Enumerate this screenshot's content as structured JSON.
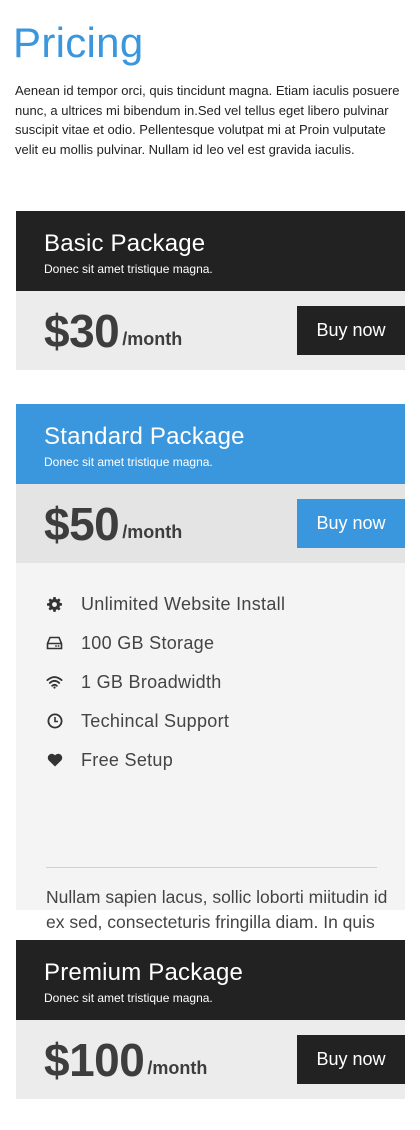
{
  "page": {
    "title": "Pricing",
    "intro": "Aenean id tempor orci, quis tincidunt magna. Etiam iaculis posuere nunc, a ultrices mi bibendum in.Sed vel tellus eget libero pulvinar suscipit vitae et odio. Pellentesque volutpat mi at Proin vulputate velit eu mollis pulvinar. Nullam id leo vel est gravida iaculis."
  },
  "plans": [
    {
      "name": "Basic Package",
      "subtitle": "Donec sit amet tristique magna.",
      "price": "$30",
      "period": "/month",
      "button": "Buy now"
    },
    {
      "name": "Standard Package",
      "subtitle": "Donec sit amet tristique magna.",
      "price": "$50",
      "period": "/month",
      "button": "Buy now",
      "features": [
        {
          "icon": "gear-icon",
          "label": "Unlimited Website Install"
        },
        {
          "icon": "hard-drive-icon",
          "label": "100 GB Storage"
        },
        {
          "icon": "wifi-icon",
          "label": "1 GB Broadwidth"
        },
        {
          "icon": "clock-icon",
          "label": "Techincal Support"
        },
        {
          "icon": "heart-icon",
          "label": "Free Setup"
        }
      ],
      "description": "Nullam sapien lacus, sollic loborti miitudin id ex sed, consecteturis fringilla diam. In quis risus"
    },
    {
      "name": "Premium Package",
      "subtitle": "Donec sit amet tristique magna.",
      "price": "$100",
      "period": "/month",
      "button": "Buy now"
    }
  ],
  "colors": {
    "accent": "#3a97dd",
    "dark": "#222222",
    "price_bg": "#ececec",
    "features_bg": "#f4f4f4"
  }
}
